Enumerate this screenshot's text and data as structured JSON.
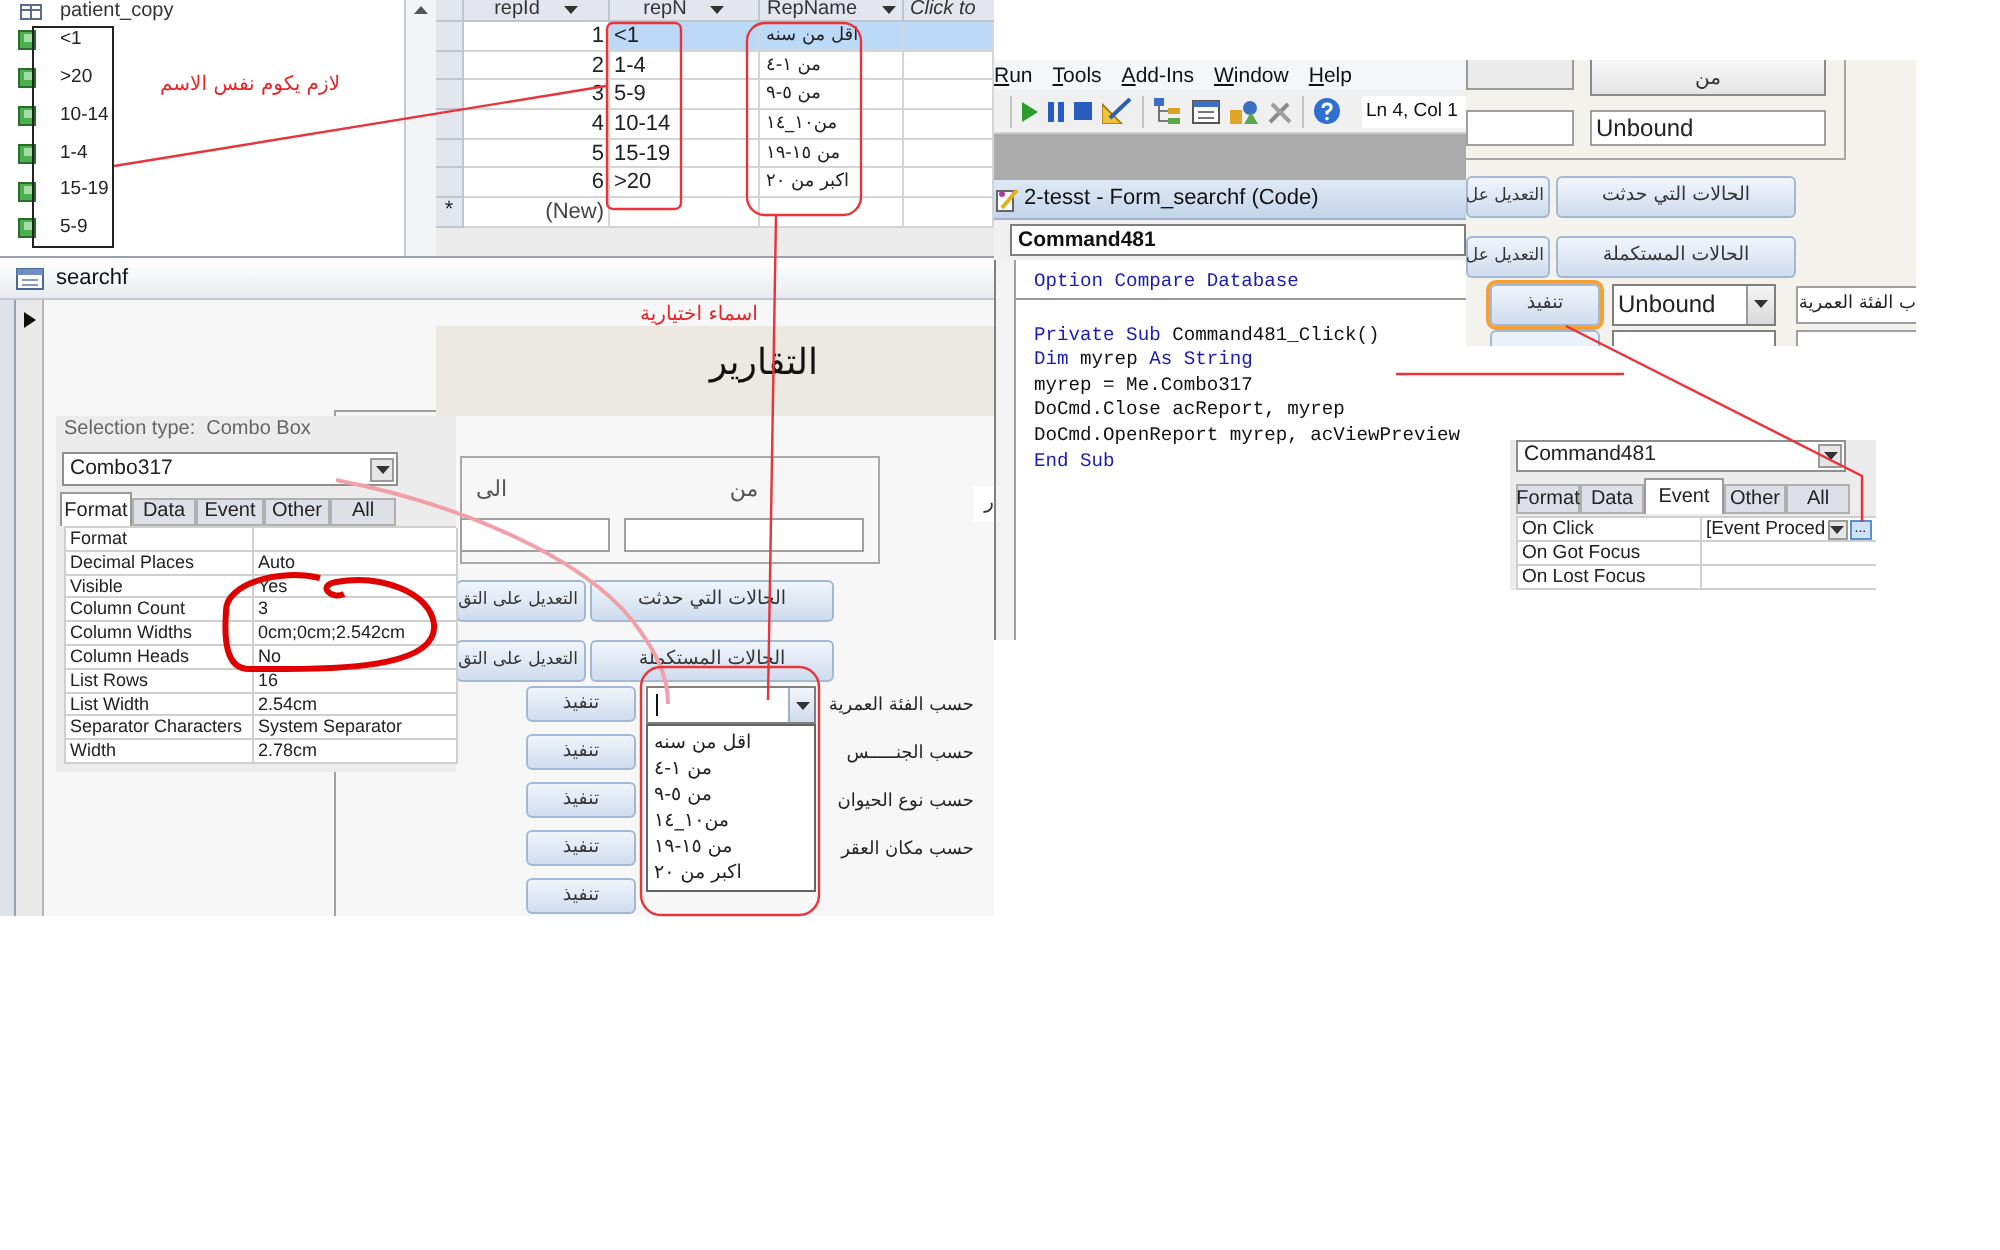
{
  "nav_pane": {
    "title": "patient_copy",
    "items": [
      {
        "label": "<1"
      },
      {
        "label": ">20"
      },
      {
        "label": "10-14"
      },
      {
        "label": "1-4"
      },
      {
        "label": "15-19"
      },
      {
        "label": "5-9"
      }
    ],
    "annotation": "لازم يكوم نفس الاسم"
  },
  "datasheet": {
    "columns": [
      {
        "label": "Click to",
        "kind": "add"
      },
      {
        "label": "RepName",
        "kind": "field"
      },
      {
        "label": "repN",
        "kind": "field"
      },
      {
        "label": "repId",
        "kind": "field"
      }
    ],
    "rows": [
      {
        "cells": [
          "",
          "اقل من سنه",
          "<1",
          "1"
        ],
        "selected": true
      },
      {
        "cells": [
          "",
          "من ١-٤",
          "1-4",
          "2"
        ],
        "selected": false
      },
      {
        "cells": [
          "",
          "من ٥-٩",
          "5-9",
          "3"
        ],
        "selected": false
      },
      {
        "cells": [
          "",
          "من١٠_١٤",
          "10-14",
          "4"
        ],
        "selected": false
      },
      {
        "cells": [
          "",
          "من ١٥-١٩",
          "15-19",
          "5"
        ],
        "selected": false
      },
      {
        "cells": [
          "",
          "اكبر من ٢٠",
          ">20",
          "6"
        ],
        "selected": false
      }
    ],
    "new_row": {
      "marker": "*",
      "label": "(New)"
    }
  },
  "form_window": {
    "title": "searchf",
    "annotation": "اسماء اختيارية",
    "heading": "التقارير",
    "date_labels": [
      "من",
      "الى"
    ],
    "cut_label": "ر",
    "buttons": [
      {
        "label": "الحالات التي حدثت"
      },
      {
        "label": "التعديل على التق"
      },
      {
        "label": "الحالات المستكملة"
      },
      {
        "label": "التعديل على التق"
      }
    ],
    "reports": [
      {
        "button": "تنفيذ",
        "label": "حسب الفئة العمرية"
      },
      {
        "button": "تنفيذ",
        "label": "حسب الجنـــــس"
      },
      {
        "button": "تنفيذ",
        "label": "حسب نوع الحيوان"
      },
      {
        "button": "تنفيذ",
        "label": "حسب مكان العقر"
      },
      {
        "button": "تنفيذ"
      }
    ],
    "combo": {
      "expanded": true,
      "options": [
        "اقل من سنه",
        "من ١-٤",
        "من ٥-٩",
        "من١٠_١٤",
        "من ١٥-١٩",
        "اكبر من ٢٠"
      ]
    }
  },
  "property_sheet": {
    "selection_type": "Selection type:  Combo Box",
    "object": "Combo317",
    "tabs": [
      {
        "label": "All",
        "selected": false
      },
      {
        "label": "Other",
        "selected": false
      },
      {
        "label": "Event",
        "selected": false
      },
      {
        "label": "Data",
        "selected": false
      },
      {
        "label": "Format",
        "selected": true
      }
    ],
    "properties": [
      {
        "name": "Format"
      },
      {
        "name": "Decimal Places",
        "value": "Auto"
      },
      {
        "name": "Visible",
        "value": "Yes"
      },
      {
        "name": "Column Count",
        "value": "3"
      },
      {
        "name": "Column Widths",
        "value": "0cm;0cm;2.542cm"
      },
      {
        "name": "Column Heads",
        "value": "No"
      },
      {
        "name": "List Rows",
        "value": "16"
      },
      {
        "name": "List Width",
        "value": "2.54cm"
      },
      {
        "name": "Separator Characters",
        "value": "System Separator"
      },
      {
        "name": "Width",
        "value": "2.78cm"
      }
    ]
  },
  "vba_editor": {
    "menu": [
      "Help",
      "Window",
      "Add-Ins",
      "Tools",
      "Run"
    ],
    "position": "Ln 4, Col 1",
    "code_window": {
      "title": "2-tesst - Form_searchf (Code)",
      "object": "Command481",
      "sections": [
        {
          "lines": [
            [
              {
                "kind": "keyword",
                "text": "Option Compare Database"
              }
            ]
          ]
        },
        {
          "lines": [
            [
              {
                "kind": "plain",
                "text": " Command481_Click()"
              },
              {
                "kind": "keyword",
                "text": "Private Sub"
              }
            ],
            [
              {
                "kind": "keyword",
                "text": "As String"
              },
              {
                "kind": "plain",
                "text": " myrep "
              },
              {
                "kind": "keyword",
                "text": "Dim"
              }
            ],
            [
              {
                "kind": "plain",
                "text": "myrep = Me.Combo317"
              }
            ],
            [
              {
                "kind": "plain",
                "text": "DoCmd.Close acReport, myrep"
              }
            ],
            [
              {
                "kind": "plain",
                "text": "DoCmd.OpenReport myrep, acViewPreview"
              }
            ],
            [
              {
                "kind": "keyword",
                "text": "End Sub"
              }
            ]
          ]
        }
      ]
    }
  },
  "right_form": {
    "from_label": "من",
    "from_value": "Unbound",
    "buttons": [
      {
        "label": "الحالات التي حدثت"
      },
      {
        "label": "التعديل عل"
      },
      {
        "label": "الحالات المستكملة"
      },
      {
        "label": "التعديل عل"
      }
    ],
    "run_button": {
      "label": "تنفيذ",
      "selected": true
    },
    "combo_value": "Unbound",
    "report_label": "ب الفئة العمرية"
  },
  "event_sheet": {
    "object": "Command481",
    "tabs": [
      {
        "label": "All",
        "selected": false
      },
      {
        "label": "Other",
        "selected": false
      },
      {
        "label": "Event",
        "selected": true
      },
      {
        "label": "Data",
        "selected": false
      },
      {
        "label": "Format",
        "selected": false
      }
    ],
    "properties": [
      {
        "name": "On Click",
        "value": "[Event Proced",
        "builder": "..."
      },
      {
        "name": "On Got Focus"
      },
      {
        "name": "On Lost Focus"
      }
    ]
  }
}
